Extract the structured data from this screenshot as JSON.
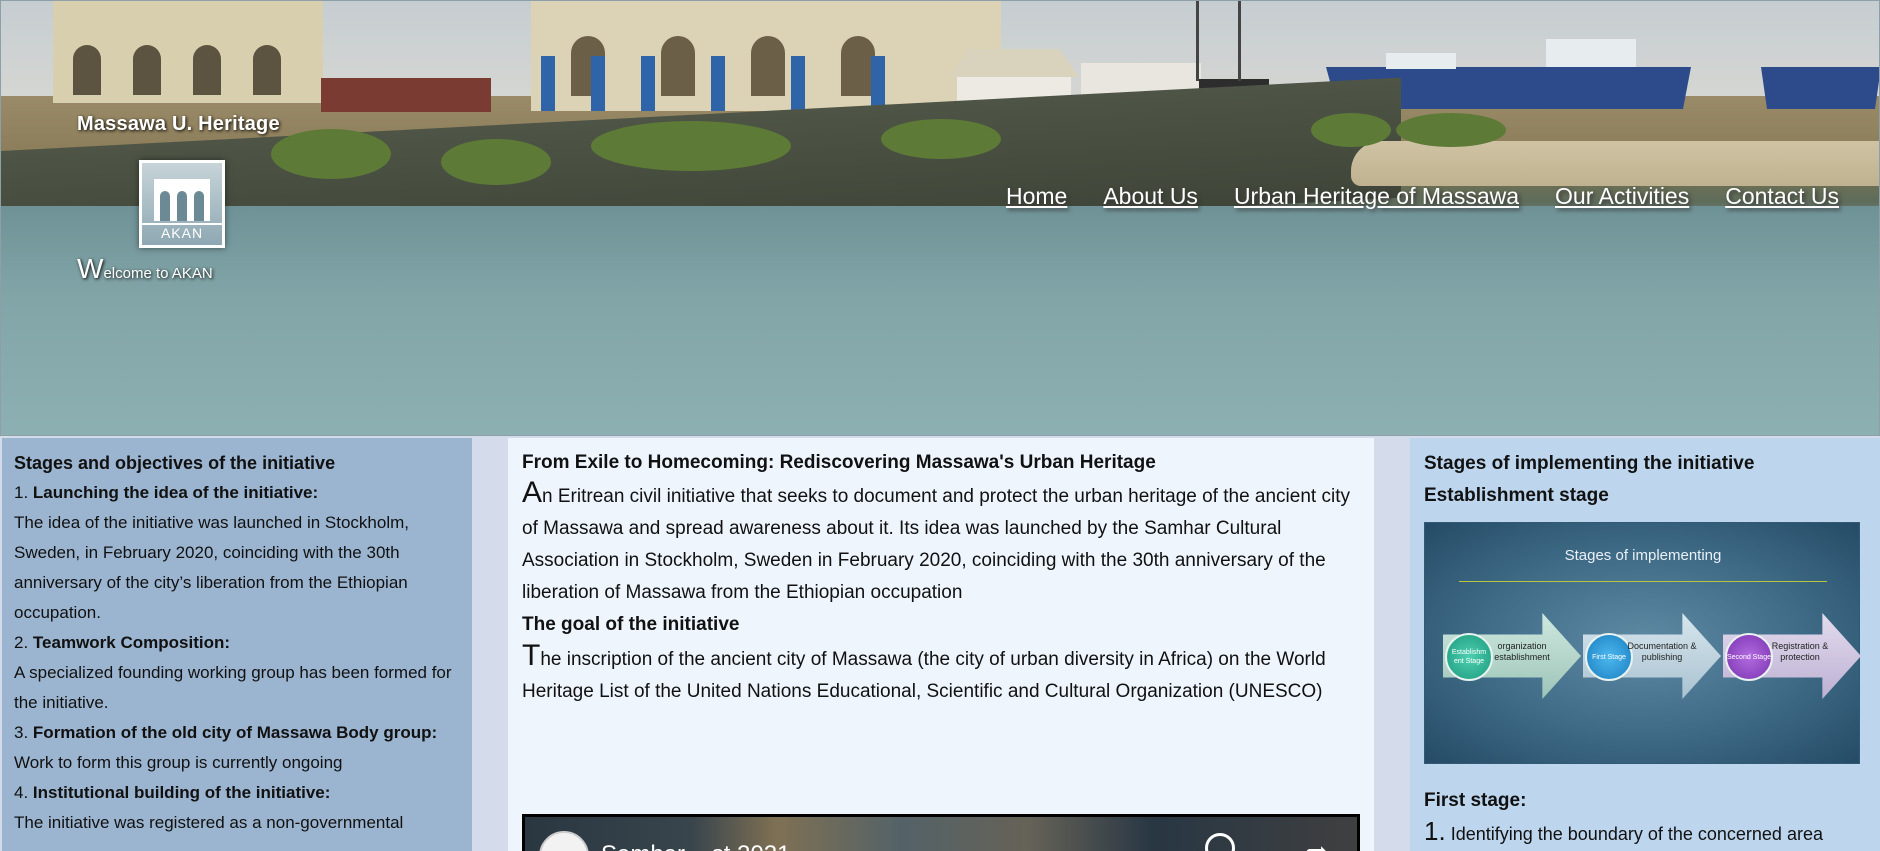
{
  "header": {
    "site_title": "Massawa U. Heritage",
    "logo_text": "AKAN",
    "welcome_first": "W",
    "welcome_rest": "elcome to AKAN"
  },
  "nav": {
    "items": [
      {
        "label": "Home"
      },
      {
        "label": "About Us"
      },
      {
        "label": "Urban Heritage of Massawa"
      },
      {
        "label": "Our Activities"
      },
      {
        "label": "Contact Us"
      }
    ]
  },
  "left": {
    "heading": "Stages and objectives of the initiative",
    "items": [
      {
        "num": "1.",
        "title": "Launching the idea of the initiative:",
        "text": "The idea of the initiative was launched in Stockholm, Sweden, in February 2020, coinciding with the 30th anniversary of the city’s liberation from the Ethiopian occupation."
      },
      {
        "num": "2.",
        "title": "Teamwork Composition:",
        "text": "A specialized founding working group has been formed for the initiative."
      },
      {
        "num": "3.",
        "title": "Formation of the old city of Massawa Body group:",
        "text": "Work to form this group is currently ongoing"
      },
      {
        "num": "4.",
        "title": "Institutional building of the initiative:",
        "text": "The initiative was registered as a non-governmental"
      }
    ]
  },
  "main": {
    "title": "From Exile to Homecoming: Rediscovering Massawa's Urban Heritage",
    "intro_first": "A",
    "intro_rest": "n Eritrean civil initiative that seeks to document and protect the urban heritage of the ancient city of Massawa and spread awareness about it. Its idea was launched by the Samhar Cultural Association in Stockholm, Sweden in February 2020, coinciding with the 30th anniversary of the liberation of Massawa from the Ethiopian occupation",
    "goal_heading": "The goal of the initiative",
    "goal_first": "T",
    "goal_rest": "he inscription of the ancient city of Massawa (the city of urban diversity in Africa) on the World Heritage List of the United Nations Educational, Scientific and Cultural Organization (UNESCO)",
    "video_title": "Samhar ...st 2021"
  },
  "right": {
    "heading": "Stages of implementing the initiative",
    "subheading": "Establishment stage",
    "image": {
      "title": "Stages of implementing",
      "stages": [
        {
          "circle": "Establishm ent Stage",
          "label": "organization establishment"
        },
        {
          "circle": "First Stage",
          "label": "Documentation & publishing"
        },
        {
          "circle": "Second Stage",
          "label": "Registration & protection"
        }
      ]
    },
    "first_stage_heading": "First stage:",
    "first_item_num": "1.",
    "first_item_text": "Identifying the boundary of the concerned area"
  },
  "colors": {
    "left_bg": "#9bb4cf",
    "mid_bg": "#eef5fd",
    "right_bg": "#bdd6ee",
    "page_bg": "#d4dceb"
  }
}
